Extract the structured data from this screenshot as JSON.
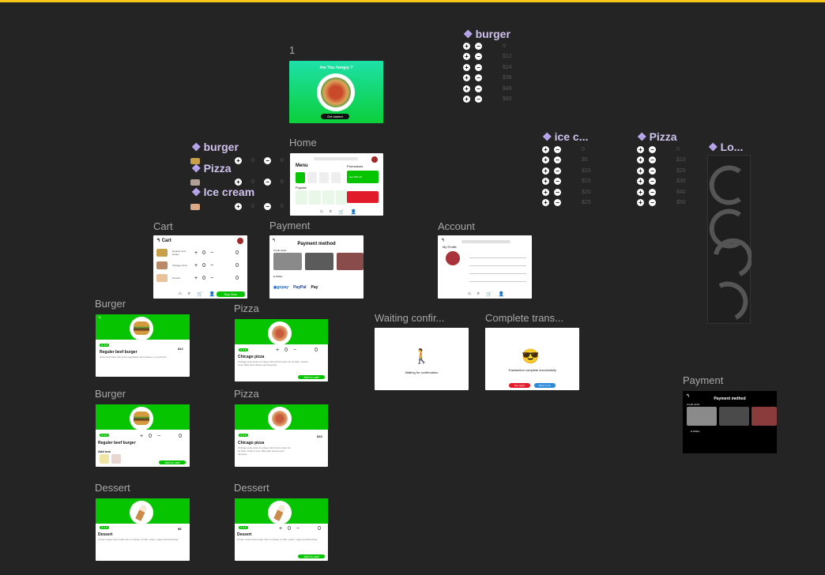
{
  "labels": {
    "one": "1",
    "home": "Home",
    "cart": "Cart",
    "payment": "Payment",
    "account": "Account",
    "burger1": "Burger",
    "burger2": "Burger",
    "pizza1": "Pizza",
    "pizza2": "Pizza",
    "dessert1": "Dessert",
    "dessert2": "Dessert",
    "waiting": "Waiting confir...",
    "complete": "Complete trans...",
    "payment_dark": "Payment"
  },
  "components": {
    "burger_top": "burger",
    "burger_left": "burger",
    "pizza_left": "Pizza",
    "icecream_left": "Ice cream",
    "icecream_mid": "ice c...",
    "pizza_mid": "Pizza",
    "lo": "Lo..."
  },
  "splash": {
    "title": "Are You Hungry ?",
    "button": "Get started"
  },
  "home": {
    "menu": "Menu",
    "promotions": "Promotions",
    "popular": "Popular",
    "promo_text": "Get 30% off"
  },
  "cart": {
    "title": "Cart",
    "items": [
      {
        "name": "Reguler beef burger",
        "qty": "0",
        "price": "0"
      },
      {
        "name": "Chicago pizza",
        "qty": "0",
        "price": "0"
      },
      {
        "name": "Dessert",
        "qty": "0",
        "price": "0"
      }
    ],
    "buy": "Buy Now"
  },
  "payment": {
    "title": "Payment method",
    "credit": "Credit cards",
    "ewallet": "E-Wallet",
    "paypal": "PayPal",
    "applepay": "Pay"
  },
  "account": {
    "title": "My Profile"
  },
  "burger_top_values": [
    "0",
    "$12",
    "$24",
    "$36",
    "$48",
    "$60"
  ],
  "icecream_values": [
    "0",
    "$5",
    "$10",
    "$15",
    "$20",
    "$25"
  ],
  "pizza_values": [
    "0",
    "$10",
    "$20",
    "$30",
    "$40",
    "$50"
  ],
  "mini_rows": {
    "burger": "0",
    "pizza": "0",
    "icecream": "0"
  },
  "product": {
    "rating": "4.5",
    "burger_name": "Reguler beef burger",
    "burger_desc": "Juicy beef patty with fresh vegetables and cheese on a soft bun.",
    "burger_price": "$12",
    "add_ons": "Add ons",
    "pizza_name": "Chicago pizza",
    "pizza_desc": "Chicago-style pizza is a deep-dish pizza known for its thick, buttery crust, filled with cheese and toppings.",
    "pizza_price": "$10",
    "dessert_name": "Dessert",
    "dessert_desc": "Frozen sweet treat made from a mixture of milk, cream, sugar and flavorings.",
    "dessert_price": "$5",
    "qty": "0",
    "price0": "0",
    "add_to_cart": "Add to cart"
  },
  "waiting": {
    "text": "Waiting for confirmation"
  },
  "complete": {
    "text": "Transaction complete successfully",
    "buy_again": "Buy Again",
    "back_home": "Back home"
  }
}
